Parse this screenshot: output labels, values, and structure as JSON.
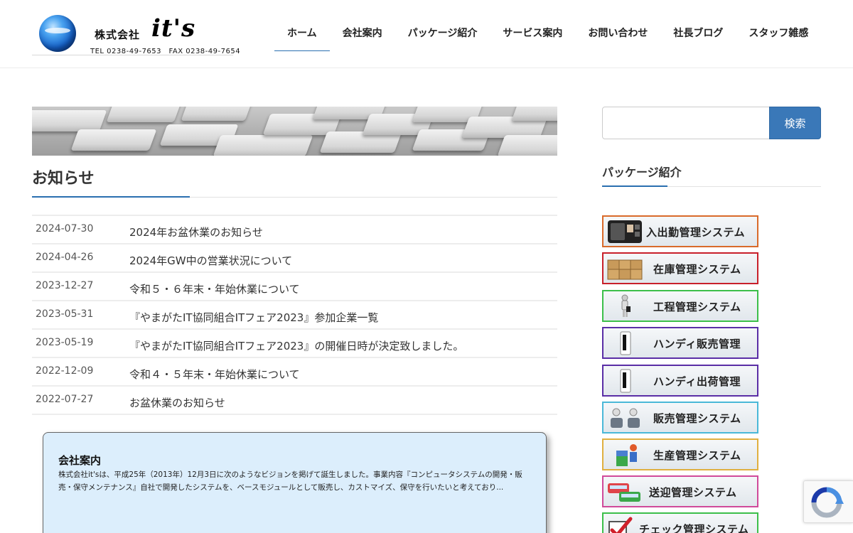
{
  "header": {
    "company": "株式会社",
    "brand": "it's",
    "contact": "TEL 0238-49-7653　FAX 0238-49-7654",
    "nav": [
      {
        "label": "ホーム",
        "active": true
      },
      {
        "label": "会社案内",
        "active": false
      },
      {
        "label": "パッケージ紹介",
        "active": false
      },
      {
        "label": "サービス案内",
        "active": false
      },
      {
        "label": "お問い合わせ",
        "active": false
      },
      {
        "label": "社長ブログ",
        "active": false
      },
      {
        "label": "スタッフ雑感",
        "active": false
      }
    ]
  },
  "main": {
    "title": "お知らせ",
    "news": [
      {
        "date": "2024-07-30",
        "title": "2024年お盆休業のお知らせ"
      },
      {
        "date": "2024-04-26",
        "title": "2024年GW中の営業状況について"
      },
      {
        "date": "2023-12-27",
        "title": "令和５・６年末・年始休業について"
      },
      {
        "date": "2023-05-31",
        "title": "『やまがたIT協同組合ITフェア2023』参加企業一覧"
      },
      {
        "date": "2023-05-19",
        "title": "『やまがたIT協同組合ITフェア2023』の開催日時が決定致しました。"
      },
      {
        "date": "2022-12-09",
        "title": "令和４・５年末・年始休業について"
      },
      {
        "date": "2022-07-27",
        "title": "お盆休業のお知らせ"
      }
    ],
    "about": {
      "title": "会社案内",
      "text": "株式会社it'sは、平成25年（2013年）12月3日に次のようなビジョンを掲げて誕生しました。事業内容『コンピュータシステムの開発・販売・保守メンテナンス』自社で開発したシステムを、ベースモジュールとして販売し、カストマイズ、保守を行いたいと考えており..."
    }
  },
  "sidebar": {
    "search_button": "検索",
    "search_placeholder": "",
    "title": "パッケージ紹介",
    "packages": [
      {
        "label": "入出勤管理システム",
        "border": "#d96a2a",
        "icon": "timecard-terminal-icon"
      },
      {
        "label": "在庫管理システム",
        "border": "#c8202a",
        "icon": "boxes-icon"
      },
      {
        "label": "工程管理システム",
        "border": "#3cbf4a",
        "icon": "worker-figure-icon"
      },
      {
        "label": "ハンディ販売管理",
        "border": "#5a2ea6",
        "icon": "handheld-terminal-icon"
      },
      {
        "label": "ハンディ出荷管理",
        "border": "#5a2ea6",
        "icon": "handheld-terminal-icon"
      },
      {
        "label": "販売管理システム",
        "border": "#4ab8d8",
        "icon": "sales-people-icon"
      },
      {
        "label": "生産管理システム",
        "border": "#e0b040",
        "icon": "factory-worker-icon"
      },
      {
        "label": "送迎管理システム",
        "border": "#d04a9a",
        "icon": "bus-icon"
      },
      {
        "label": "チェック管理システム",
        "border": "#3cbf4a",
        "icon": "checkmark-icon"
      }
    ]
  }
}
